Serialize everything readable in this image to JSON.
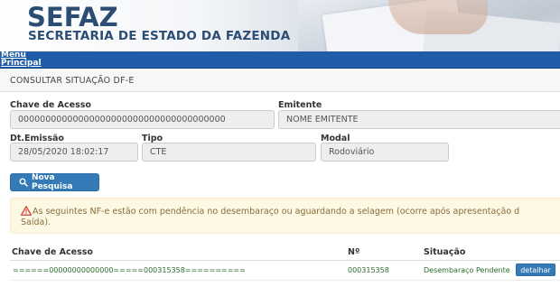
{
  "header": {
    "brand": "SEFAZ",
    "subtitle": "SECRETARIA DE ESTADO DA FAZENDA"
  },
  "nav": {
    "menu": "Menu",
    "principal": "Principal"
  },
  "page": {
    "title": "CONSULTAR SITUAÇÃO DF-E"
  },
  "form": {
    "chave_label": "Chave de Acesso",
    "chave_value": "00000000000000000000000000000000000000",
    "emitente_label": "Emitente",
    "emitente_value": "NOME EMITENTE",
    "dt_label": "Dt.Emissão",
    "dt_value": "28/05/2020 18:02:17",
    "tipo_label": "Tipo",
    "tipo_value": "CTE",
    "modal_label": "Modal",
    "modal_value": "Rodoviário"
  },
  "actions": {
    "nova_pesquisa": "Nova Pesquisa"
  },
  "alert": {
    "line1": "As seguintes NF-e estão com pendência no desembaraço ou aguardando a selagem (ocorre após apresentação d",
    "line2": "Saída)."
  },
  "table": {
    "headers": [
      "Chave de Acesso",
      "Nº",
      "Situação"
    ],
    "rows": [
      {
        "chave": "======00000000000000=====000315358==========",
        "numero": "000315358",
        "situacao": "Desembaraço Pendente",
        "action": "detalhar"
      }
    ]
  },
  "colors": {
    "brand": "#2b4d74",
    "nav": "#1f5da8",
    "primary_button": "#337ab7",
    "alert_bg": "#fcf8e3",
    "alert_text": "#8a6d3b",
    "warning_icon": "#d9534f",
    "row_text": "#2d6b2d"
  },
  "icons": {
    "search": "search-icon",
    "warning": "warning-icon"
  }
}
